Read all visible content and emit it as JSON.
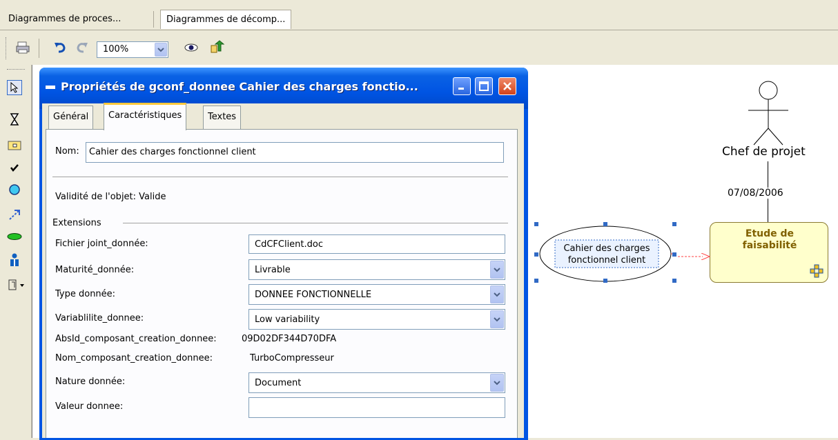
{
  "doc_tabs": [
    {
      "label": "Diagrammes de proces..."
    },
    {
      "label": "Diagrammes de décomp..."
    }
  ],
  "toolbar": {
    "zoom": "100%",
    "icons": [
      "print-icon",
      "undo-icon",
      "redo-icon",
      "zoom-dropdown-icon",
      "eye-icon",
      "export-icon"
    ]
  },
  "palette": {
    "icons": [
      "pointer-icon",
      "hourglass-icon",
      "component-icon",
      "check-icon",
      "circle-icon",
      "link-arrow-icon",
      "ellipse-data-icon",
      "actor-icon",
      "tools-menu-icon"
    ]
  },
  "dialog": {
    "title": "Propriétés de gconf_donnee Cahier des charges fonctio...",
    "tabs": [
      {
        "label": "Général"
      },
      {
        "label": "Caractéristiques"
      },
      {
        "label": "Textes"
      }
    ],
    "nom_label": "Nom:",
    "nom_value": "Cahier des charges fonctionnel client",
    "validite": "Validité de l'objet: Valide",
    "extensions_label": "Extensions",
    "fields": {
      "fichier_label": "Fichier joint_donnée:",
      "fichier_value": "CdCFClient.doc",
      "maturite_label": "Maturité_donnée:",
      "maturite_value": "Livrable",
      "type_label": "Type donnée:",
      "type_value": "DONNEE FONCTIONNELLE",
      "variab_label": "Variablilite_donnee:",
      "variab_value": "Low variability",
      "absid_label": "AbsId_composant_creation_donnee:",
      "absid_value": "09D02DF344D70DFA",
      "nomcomp_label": "Nom_composant_creation_donnee:",
      "nomcomp_value": "TurboCompresseur",
      "nature_label": "Nature donnée:",
      "nature_value": "Document",
      "valeur_label": "Valeur donnee:",
      "valeur_value": ""
    }
  },
  "diagram": {
    "actor_label": "Chef de projet",
    "date_label": "07/08/2006",
    "data_node_line1": "Cahier des charges",
    "data_node_line2": "fonctionnel client",
    "activity_line1": "Etude de",
    "activity_line2": "faisabilité"
  },
  "colors": {
    "title_bar": "#0054e3",
    "activity_fill": "#ffffcc",
    "activity_text": "#806000",
    "flow_arrow": "#ff4040",
    "selection": "#316ac5"
  }
}
